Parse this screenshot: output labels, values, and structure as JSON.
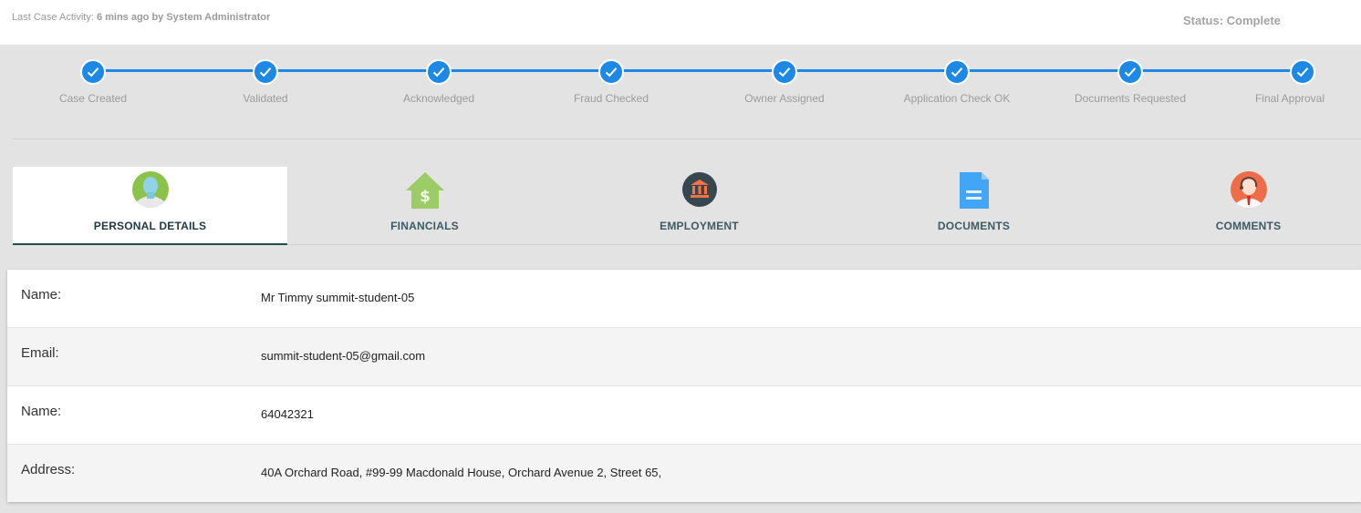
{
  "header": {
    "activity_prefix": "Last Case Activity:",
    "activity_detail": "6 mins ago by System Administrator",
    "status": "Status: Complete"
  },
  "progress": {
    "accent_color": "#1e88e5",
    "steps": [
      {
        "label": "Case Created",
        "complete": true
      },
      {
        "label": "Validated",
        "complete": true
      },
      {
        "label": "Acknowledged",
        "complete": true
      },
      {
        "label": "Fraud Checked",
        "complete": true
      },
      {
        "label": "Owner Assigned",
        "complete": true
      },
      {
        "label": "Application Check OK",
        "complete": true
      },
      {
        "label": "Documents Requested",
        "complete": true
      },
      {
        "label": "Final Approval",
        "complete": true
      }
    ]
  },
  "tabs": [
    {
      "label": "PERSONAL DETAILS",
      "icon": "person-avatar-icon",
      "active": true
    },
    {
      "label": "FINANCIALS",
      "icon": "house-dollar-icon",
      "active": false
    },
    {
      "label": "EMPLOYMENT",
      "icon": "bank-building-icon",
      "active": false
    },
    {
      "label": "DOCUMENTS",
      "icon": "document-icon",
      "active": false
    },
    {
      "label": "COMMENTS",
      "icon": "support-agent-icon",
      "active": false
    }
  ],
  "details": [
    {
      "label": "Name:",
      "value": "Mr Timmy summit-student-05"
    },
    {
      "label": "Email:",
      "value": "summit-student-05@gmail.com"
    },
    {
      "label": "Name:",
      "value": "64042321"
    },
    {
      "label": "Address:",
      "value": "40A Orchard Road, #99-99 Macdonald House, Orchard Avenue 2, Street 65,"
    }
  ]
}
